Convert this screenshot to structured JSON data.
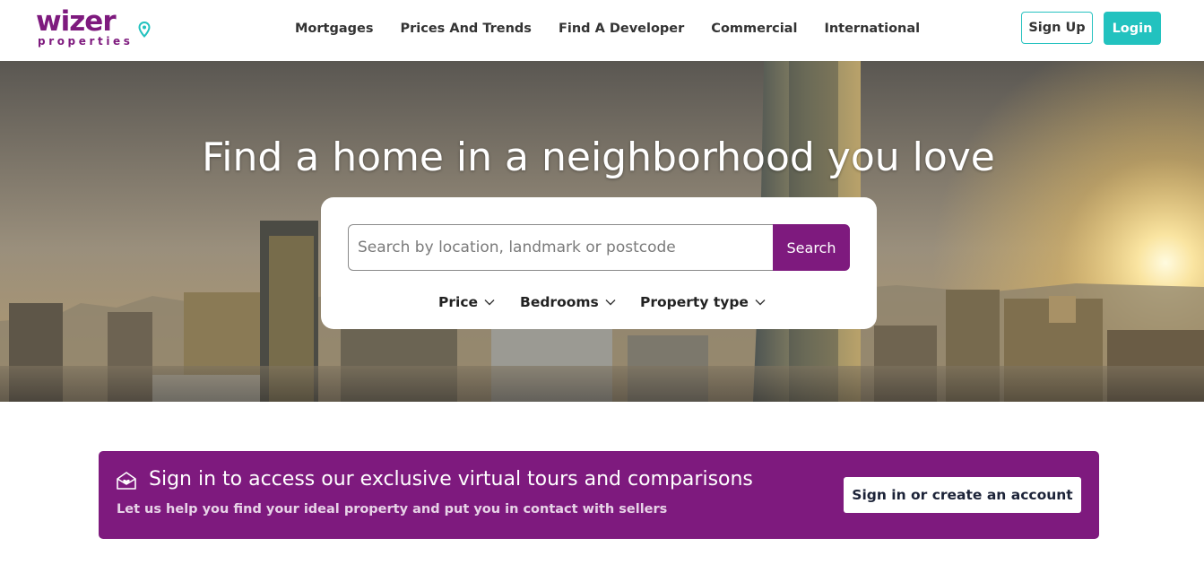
{
  "header": {
    "logo_main": "wizer",
    "logo_sub": "properties",
    "nav": [
      "Mortgages",
      "Prices And Trends",
      "Find A Developer",
      "Commercial",
      "International"
    ],
    "signup_label": "Sign Up",
    "login_label": "Login"
  },
  "hero": {
    "title": "Find a home in a neighborhood you love",
    "search_placeholder": "Search by location, landmark or postcode",
    "search_value": "",
    "search_label": "Search",
    "filters": [
      "Price",
      "Bedrooms",
      "Property type"
    ]
  },
  "banner": {
    "title": "Sign in to access our exclusive virtual tours and comparisons",
    "subtitle": "Let us help you find your ideal property and put you in contact with sellers",
    "button_label": "Sign in or create an account"
  },
  "colors": {
    "brand_purple": "#7e1a7e",
    "accent_teal": "#22c2bf",
    "white": "#ffffff"
  },
  "icons": {
    "logo_pin": "map-pin-icon",
    "filter_chevron": "chevron-down-icon",
    "banner": "mail-heart-icon"
  }
}
